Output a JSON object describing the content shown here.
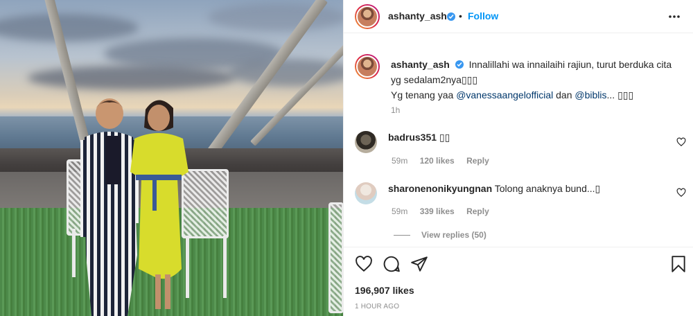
{
  "post": {
    "username": "ashanty_ash",
    "follow_label": "Follow",
    "separator": "•",
    "caption_text": "Innalillahi wa innailaihi rajiun, turut berduka cita yg sedalam2nya",
    "caption_emoji": "▯▯▯",
    "caption_line2_prefix": "Yg tenang yaa ",
    "mention1": "@vanessaangelofficial",
    "caption_mid": " dan ",
    "mention2": "@biblis",
    "caption_tail": "... ",
    "caption_emoji2": "▯▯▯",
    "caption_time": "1h",
    "likes": "196,907 likes",
    "posted_ago": "1 HOUR AGO"
  },
  "comments": [
    {
      "username": "badrus351",
      "text": "▯▯",
      "time": "59m",
      "likes": "120 likes",
      "reply": "Reply"
    },
    {
      "username": "sharonenonikyungnan",
      "text": "Tolong anaknya bund...▯",
      "time": "59m",
      "likes": "339 likes",
      "reply": "Reply"
    }
  ],
  "view_replies": "View replies (50)",
  "icons": {
    "verified": "verified-badge-icon",
    "more": "more-options-icon",
    "like": "heart-icon",
    "comment": "comment-icon",
    "share": "share-icon",
    "save": "bookmark-icon"
  },
  "colors": {
    "verified": "#3897f0",
    "follow": "#0095f6",
    "mention": "#00376b",
    "muted": "#8e8e8e"
  }
}
